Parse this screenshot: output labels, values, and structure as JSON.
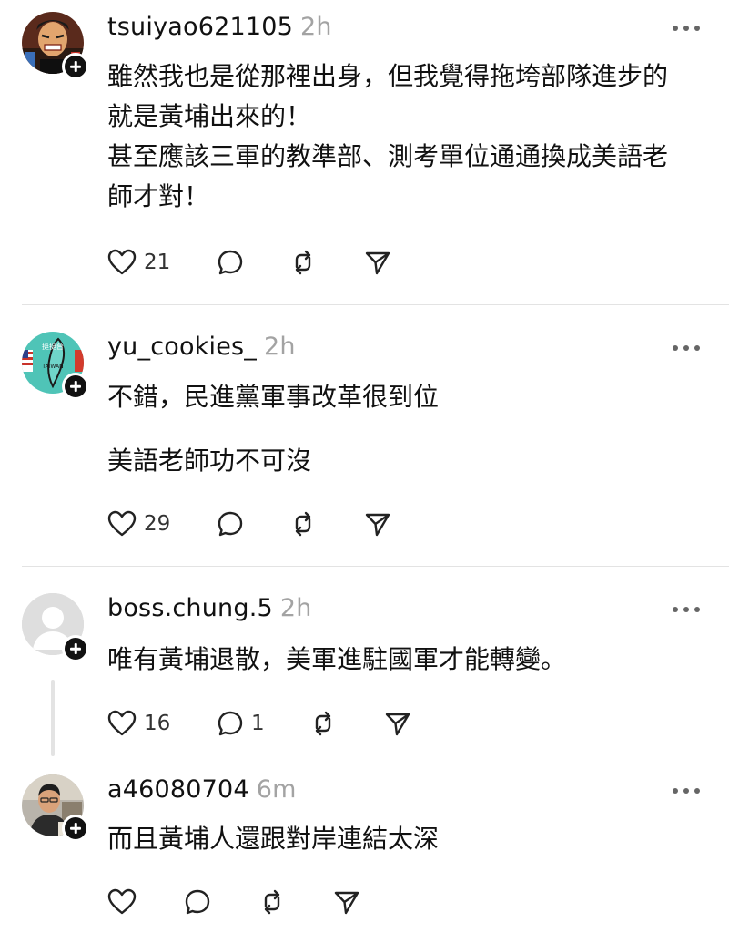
{
  "comments": [
    {
      "username": "tsuiyao621105",
      "time": "2h",
      "lines": [
        "雖然我也是從那裡出身，但我覺得拖垮部隊進步的",
        "就是黃埔出來的！",
        "甚至應該三軍的教準部、測考單位通通換成美語老",
        "師才對！"
      ],
      "likes": "21",
      "replies": ""
    },
    {
      "username": "yu_cookies_",
      "time": "2h",
      "paragraphs": [
        "不錯，民進黨軍事改革很到位",
        "美語老師功不可沒"
      ],
      "avatar_text": [
        "挺挺台",
        "TAIWAN"
      ],
      "likes": "29",
      "replies": ""
    },
    {
      "username": "boss.chung.5",
      "time": "2h",
      "lines": [
        "唯有黃埔退散，美軍進駐國軍才能轉變。"
      ],
      "likes": "16",
      "replies": "1"
    },
    {
      "username": "a46080704",
      "time": "6m",
      "lines": [
        "而且黃埔人還跟對岸連結太深"
      ],
      "likes": "",
      "replies": ""
    }
  ],
  "icons": {
    "like": "heart-icon",
    "reply": "comment-icon",
    "repost": "repost-icon",
    "share": "send-icon",
    "more": "more-dots-icon",
    "follow": "plus-icon"
  },
  "colors": {
    "text": "#111111",
    "muted": "#a3a3a3",
    "divider": "#e3e3e3",
    "badge": "#111111"
  }
}
